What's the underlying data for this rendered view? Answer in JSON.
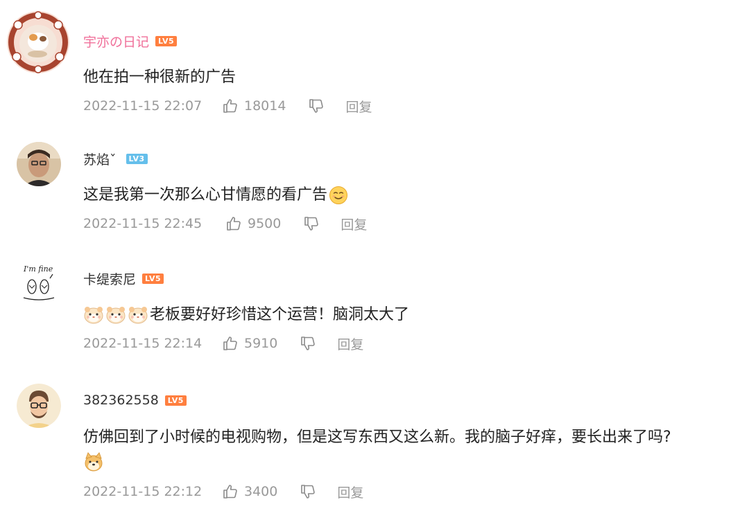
{
  "comments": [
    {
      "username": "宇亦の日记",
      "level": "LV5",
      "text": "他在拍一种很新的广告",
      "time": "2022-11-15 22:07",
      "likes": "18014",
      "reply": "回复"
    },
    {
      "username": "苏焰ˇ",
      "level": "LV3",
      "text": "这是我第一次那么心甘情愿的看广告",
      "time": "2022-11-15 22:45",
      "likes": "9500",
      "reply": "回复"
    },
    {
      "username": "卡缇索尼",
      "level": "LV5",
      "text": "老板要好好珍惜这个运营！脑洞太大了",
      "time": "2022-11-15 22:14",
      "likes": "5910",
      "reply": "回复"
    },
    {
      "username": "382362558",
      "level": "LV5",
      "text": "仿佛回到了小时候的电视购物，但是这写东西又这么新。我的脑子好痒，要长出来了吗?",
      "time": "2022-11-15 22:12",
      "likes": "3400",
      "reply": "回复"
    }
  ],
  "colors": {
    "vip_name": "#f0709a",
    "level_orange": "#ff7f3f",
    "level_blue": "#65bfeb",
    "meta_gray": "#999999"
  },
  "avatar_texts": {
    "comment3": "I'm fine"
  }
}
